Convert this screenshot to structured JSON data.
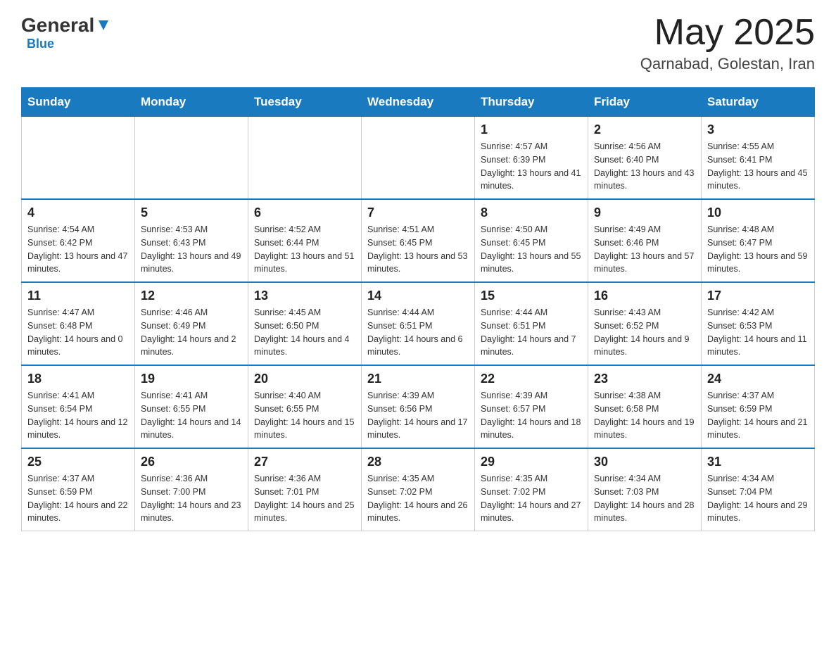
{
  "header": {
    "logo": {
      "general": "General",
      "blue": "Blue"
    },
    "month_title": "May 2025",
    "location": "Qarnabad, Golestan, Iran"
  },
  "days_of_week": [
    "Sunday",
    "Monday",
    "Tuesday",
    "Wednesday",
    "Thursday",
    "Friday",
    "Saturday"
  ],
  "weeks": [
    [
      {
        "day": "",
        "sunrise": "",
        "sunset": "",
        "daylight": ""
      },
      {
        "day": "",
        "sunrise": "",
        "sunset": "",
        "daylight": ""
      },
      {
        "day": "",
        "sunrise": "",
        "sunset": "",
        "daylight": ""
      },
      {
        "day": "",
        "sunrise": "",
        "sunset": "",
        "daylight": ""
      },
      {
        "day": "1",
        "sunrise": "Sunrise: 4:57 AM",
        "sunset": "Sunset: 6:39 PM",
        "daylight": "Daylight: 13 hours and 41 minutes."
      },
      {
        "day": "2",
        "sunrise": "Sunrise: 4:56 AM",
        "sunset": "Sunset: 6:40 PM",
        "daylight": "Daylight: 13 hours and 43 minutes."
      },
      {
        "day": "3",
        "sunrise": "Sunrise: 4:55 AM",
        "sunset": "Sunset: 6:41 PM",
        "daylight": "Daylight: 13 hours and 45 minutes."
      }
    ],
    [
      {
        "day": "4",
        "sunrise": "Sunrise: 4:54 AM",
        "sunset": "Sunset: 6:42 PM",
        "daylight": "Daylight: 13 hours and 47 minutes."
      },
      {
        "day": "5",
        "sunrise": "Sunrise: 4:53 AM",
        "sunset": "Sunset: 6:43 PM",
        "daylight": "Daylight: 13 hours and 49 minutes."
      },
      {
        "day": "6",
        "sunrise": "Sunrise: 4:52 AM",
        "sunset": "Sunset: 6:44 PM",
        "daylight": "Daylight: 13 hours and 51 minutes."
      },
      {
        "day": "7",
        "sunrise": "Sunrise: 4:51 AM",
        "sunset": "Sunset: 6:45 PM",
        "daylight": "Daylight: 13 hours and 53 minutes."
      },
      {
        "day": "8",
        "sunrise": "Sunrise: 4:50 AM",
        "sunset": "Sunset: 6:45 PM",
        "daylight": "Daylight: 13 hours and 55 minutes."
      },
      {
        "day": "9",
        "sunrise": "Sunrise: 4:49 AM",
        "sunset": "Sunset: 6:46 PM",
        "daylight": "Daylight: 13 hours and 57 minutes."
      },
      {
        "day": "10",
        "sunrise": "Sunrise: 4:48 AM",
        "sunset": "Sunset: 6:47 PM",
        "daylight": "Daylight: 13 hours and 59 minutes."
      }
    ],
    [
      {
        "day": "11",
        "sunrise": "Sunrise: 4:47 AM",
        "sunset": "Sunset: 6:48 PM",
        "daylight": "Daylight: 14 hours and 0 minutes."
      },
      {
        "day": "12",
        "sunrise": "Sunrise: 4:46 AM",
        "sunset": "Sunset: 6:49 PM",
        "daylight": "Daylight: 14 hours and 2 minutes."
      },
      {
        "day": "13",
        "sunrise": "Sunrise: 4:45 AM",
        "sunset": "Sunset: 6:50 PM",
        "daylight": "Daylight: 14 hours and 4 minutes."
      },
      {
        "day": "14",
        "sunrise": "Sunrise: 4:44 AM",
        "sunset": "Sunset: 6:51 PM",
        "daylight": "Daylight: 14 hours and 6 minutes."
      },
      {
        "day": "15",
        "sunrise": "Sunrise: 4:44 AM",
        "sunset": "Sunset: 6:51 PM",
        "daylight": "Daylight: 14 hours and 7 minutes."
      },
      {
        "day": "16",
        "sunrise": "Sunrise: 4:43 AM",
        "sunset": "Sunset: 6:52 PM",
        "daylight": "Daylight: 14 hours and 9 minutes."
      },
      {
        "day": "17",
        "sunrise": "Sunrise: 4:42 AM",
        "sunset": "Sunset: 6:53 PM",
        "daylight": "Daylight: 14 hours and 11 minutes."
      }
    ],
    [
      {
        "day": "18",
        "sunrise": "Sunrise: 4:41 AM",
        "sunset": "Sunset: 6:54 PM",
        "daylight": "Daylight: 14 hours and 12 minutes."
      },
      {
        "day": "19",
        "sunrise": "Sunrise: 4:41 AM",
        "sunset": "Sunset: 6:55 PM",
        "daylight": "Daylight: 14 hours and 14 minutes."
      },
      {
        "day": "20",
        "sunrise": "Sunrise: 4:40 AM",
        "sunset": "Sunset: 6:55 PM",
        "daylight": "Daylight: 14 hours and 15 minutes."
      },
      {
        "day": "21",
        "sunrise": "Sunrise: 4:39 AM",
        "sunset": "Sunset: 6:56 PM",
        "daylight": "Daylight: 14 hours and 17 minutes."
      },
      {
        "day": "22",
        "sunrise": "Sunrise: 4:39 AM",
        "sunset": "Sunset: 6:57 PM",
        "daylight": "Daylight: 14 hours and 18 minutes."
      },
      {
        "day": "23",
        "sunrise": "Sunrise: 4:38 AM",
        "sunset": "Sunset: 6:58 PM",
        "daylight": "Daylight: 14 hours and 19 minutes."
      },
      {
        "day": "24",
        "sunrise": "Sunrise: 4:37 AM",
        "sunset": "Sunset: 6:59 PM",
        "daylight": "Daylight: 14 hours and 21 minutes."
      }
    ],
    [
      {
        "day": "25",
        "sunrise": "Sunrise: 4:37 AM",
        "sunset": "Sunset: 6:59 PM",
        "daylight": "Daylight: 14 hours and 22 minutes."
      },
      {
        "day": "26",
        "sunrise": "Sunrise: 4:36 AM",
        "sunset": "Sunset: 7:00 PM",
        "daylight": "Daylight: 14 hours and 23 minutes."
      },
      {
        "day": "27",
        "sunrise": "Sunrise: 4:36 AM",
        "sunset": "Sunset: 7:01 PM",
        "daylight": "Daylight: 14 hours and 25 minutes."
      },
      {
        "day": "28",
        "sunrise": "Sunrise: 4:35 AM",
        "sunset": "Sunset: 7:02 PM",
        "daylight": "Daylight: 14 hours and 26 minutes."
      },
      {
        "day": "29",
        "sunrise": "Sunrise: 4:35 AM",
        "sunset": "Sunset: 7:02 PM",
        "daylight": "Daylight: 14 hours and 27 minutes."
      },
      {
        "day": "30",
        "sunrise": "Sunrise: 4:34 AM",
        "sunset": "Sunset: 7:03 PM",
        "daylight": "Daylight: 14 hours and 28 minutes."
      },
      {
        "day": "31",
        "sunrise": "Sunrise: 4:34 AM",
        "sunset": "Sunset: 7:04 PM",
        "daylight": "Daylight: 14 hours and 29 minutes."
      }
    ]
  ]
}
